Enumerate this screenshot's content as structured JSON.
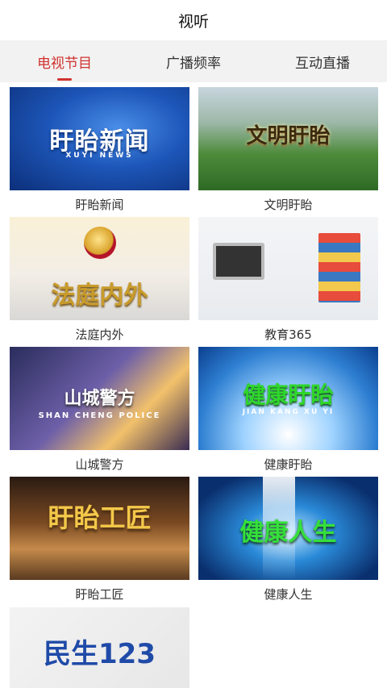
{
  "header": {
    "title": "视听"
  },
  "tabs": [
    {
      "label": "电视节目",
      "active": true
    },
    {
      "label": "广播频率",
      "active": false
    },
    {
      "label": "互动直播",
      "active": false
    }
  ],
  "programs": [
    {
      "label": "盱眙新闻",
      "thumb_text": "盱眙新闻",
      "thumb_sub": "XUYI  NEWS"
    },
    {
      "label": "文明盱眙",
      "thumb_text": "文明盱眙"
    },
    {
      "label": "法庭内外",
      "thumb_text": "法庭内外"
    },
    {
      "label": "教育365"
    },
    {
      "label": "山城警方",
      "thumb_text": "山城警方",
      "thumb_sub": "SHAN CHENG POLICE"
    },
    {
      "label": "健康盱眙",
      "thumb_text": "健康盱眙",
      "thumb_sub": "JIAN KANG XU YI"
    },
    {
      "label": "盱眙工匠",
      "thumb_text": "盱眙工匠"
    },
    {
      "label": "健康人生",
      "thumb_text": "健康人生"
    },
    {
      "label": "",
      "thumb_text": "民生123"
    }
  ],
  "colors": {
    "accent": "#d0322f",
    "tab_bg": "#f2f2f2"
  }
}
